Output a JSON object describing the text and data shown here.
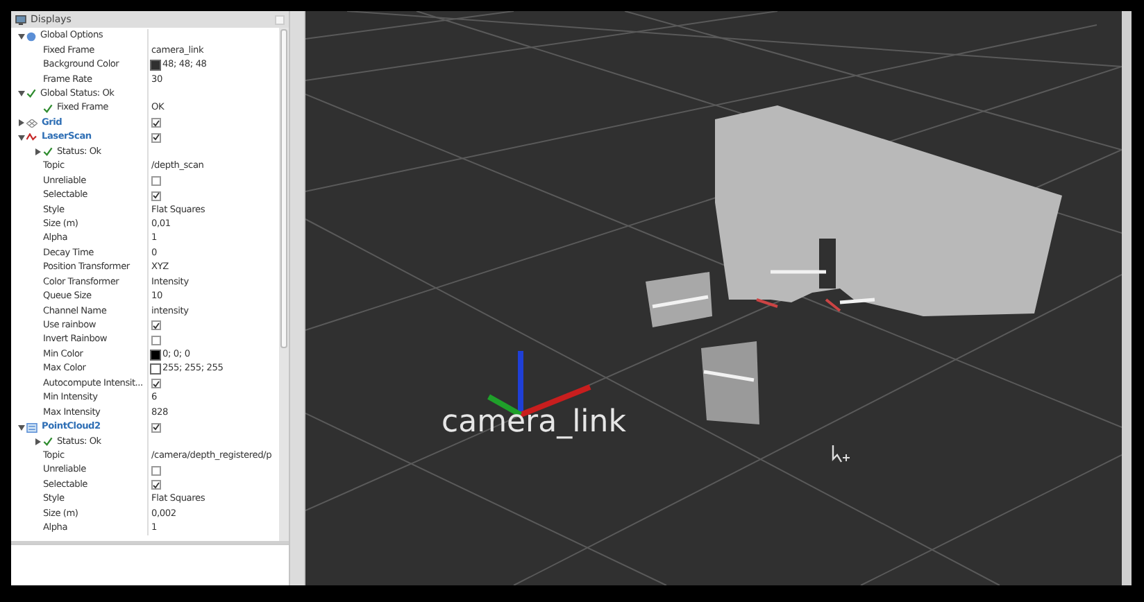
{
  "panel": {
    "title": "Displays"
  },
  "tree": [
    {
      "kind": "options",
      "label": "Global Options",
      "expanded": true,
      "children": [
        {
          "kind": "text",
          "label": "Fixed Frame",
          "value": "camera_link"
        },
        {
          "kind": "color",
          "label": "Background Color",
          "value": "48; 48; 48",
          "color": "#303030"
        },
        {
          "kind": "text",
          "label": "Frame Rate",
          "value": "30"
        }
      ]
    },
    {
      "kind": "status",
      "label": "Global Status: Ok",
      "expanded": true,
      "children": [
        {
          "kind": "status",
          "label": "Fixed Frame",
          "value": "OK"
        }
      ]
    },
    {
      "kind": "grid",
      "label": "Grid",
      "expanded": false,
      "checked": true
    },
    {
      "kind": "laserscan",
      "label": "LaserScan",
      "expanded": true,
      "checked": true,
      "children": [
        {
          "kind": "status",
          "label": "Status: Ok",
          "expanded": false
        },
        {
          "kind": "text",
          "label": "Topic",
          "value": "/depth_scan"
        },
        {
          "kind": "checkbox",
          "label": "Unreliable",
          "checked": false
        },
        {
          "kind": "checkbox",
          "label": "Selectable",
          "checked": true
        },
        {
          "kind": "text",
          "label": "Style",
          "value": "Flat Squares"
        },
        {
          "kind": "text",
          "label": "Size (m)",
          "value": "0,01"
        },
        {
          "kind": "text",
          "label": "Alpha",
          "value": "1"
        },
        {
          "kind": "text",
          "label": "Decay Time",
          "value": "0"
        },
        {
          "kind": "text",
          "label": "Position Transformer",
          "value": "XYZ"
        },
        {
          "kind": "text",
          "label": "Color Transformer",
          "value": "Intensity"
        },
        {
          "kind": "text",
          "label": "Queue Size",
          "value": "10"
        },
        {
          "kind": "text",
          "label": "Channel Name",
          "value": "intensity"
        },
        {
          "kind": "checkbox",
          "label": "Use rainbow",
          "checked": true
        },
        {
          "kind": "checkbox",
          "label": "Invert Rainbow",
          "checked": false
        },
        {
          "kind": "color",
          "label": "Min Color",
          "value": "0; 0; 0",
          "color": "#000000"
        },
        {
          "kind": "color",
          "label": "Max Color",
          "value": "255; 255; 255",
          "color": "#ffffff"
        },
        {
          "kind": "checkbox",
          "label": "Autocompute Intensit...",
          "checked": true
        },
        {
          "kind": "text",
          "label": "Min Intensity",
          "value": "6"
        },
        {
          "kind": "text",
          "label": "Max Intensity",
          "value": "828"
        }
      ]
    },
    {
      "kind": "pointcloud",
      "label": "PointCloud2",
      "expanded": true,
      "checked": true,
      "children": [
        {
          "kind": "status",
          "label": "Status: Ok",
          "expanded": false
        },
        {
          "kind": "text",
          "label": "Topic",
          "value": "/camera/depth_registered/p"
        },
        {
          "kind": "checkbox",
          "label": "Unreliable",
          "checked": false
        },
        {
          "kind": "checkbox",
          "label": "Selectable",
          "checked": true
        },
        {
          "kind": "text",
          "label": "Style",
          "value": "Flat Squares"
        },
        {
          "kind": "text",
          "label": "Size (m)",
          "value": "0,002"
        },
        {
          "kind": "text",
          "label": "Alpha",
          "value": "1"
        }
      ]
    }
  ],
  "viewport": {
    "frame_label": "camera_link"
  }
}
